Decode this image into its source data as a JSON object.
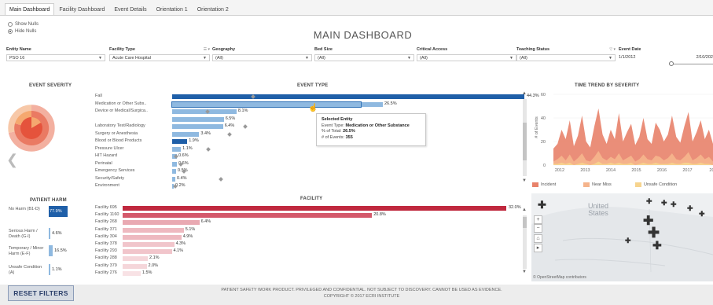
{
  "tabs": [
    {
      "label": "Main Dashboard",
      "active": true
    },
    {
      "label": "Facility Dashboard",
      "active": false
    },
    {
      "label": "Event Details",
      "active": false
    },
    {
      "label": "Orientation 1",
      "active": false
    },
    {
      "label": "Orientation 2",
      "active": false
    }
  ],
  "nulls": {
    "show": "Show Nulls",
    "hide": "Hide Nulls"
  },
  "title": "MAIN DASHBOARD",
  "filters": {
    "entity_name": {
      "label": "Entity Name",
      "value": "PSO 16"
    },
    "facility_type": {
      "label": "Facility Type",
      "value": "Acute Care Hospital",
      "ctrls": "☰ ▾"
    },
    "geography": {
      "label": "Geography",
      "value": "(All)"
    },
    "bed_size": {
      "label": "Bed Size",
      "value": "(All)"
    },
    "critical_access": {
      "label": "Critical Access",
      "value": "(All)"
    },
    "teaching_status": {
      "label": "Teaching Status",
      "value": "(All)",
      "ctrls": "▽ ▾"
    },
    "event_date": {
      "label": "Event Date",
      "start": "1/1/2012",
      "end": "2/10/202"
    }
  },
  "sections": {
    "event_severity": "EVENT SEVERITY",
    "event_type": "EVENT TYPE",
    "time_trend": "TIME TREND BY SEVERITY",
    "patient_harm": "PATIENT HARM",
    "facility": "FACILITY"
  },
  "event_type": {
    "items": [
      {
        "label": "Fall",
        "value": "44.3%",
        "pct": 44.3
      },
      {
        "label": "Medication or Other Subs..",
        "value": "26.5%",
        "pct": 26.5,
        "selected": true
      },
      {
        "label": "Device or Medical/Surgica..",
        "value": "8.1%",
        "pct": 8.1
      },
      {
        "label": "",
        "value": "6.5%",
        "pct": 6.5
      },
      {
        "label": "Laboratory Test/Radiology",
        "value": "6.4%",
        "pct": 6.4
      },
      {
        "label": "Surgery or Anesthesia",
        "value": "3.4%",
        "pct": 3.4
      },
      {
        "label": "Blood or Blood Products",
        "value": "1.9%",
        "pct": 1.9
      },
      {
        "label": "Pressure Ulcer",
        "value": "1.1%",
        "pct": 1.1
      },
      {
        "label": "HIT Hazard",
        "value": "0.6%",
        "pct": 0.6
      },
      {
        "label": "Perinatal",
        "value": "0.6%",
        "pct": 0.6
      },
      {
        "label": "Emergency Services",
        "value": "0.5%",
        "pct": 0.5
      },
      {
        "label": "Security/Safety",
        "value": "0.4%",
        "pct": 0.4
      },
      {
        "label": "Environment",
        "value": "0.2%",
        "pct": 0.2
      }
    ]
  },
  "tooltip": {
    "title": "Selected Entity",
    "event_type_label": "Event Type:",
    "event_type_value": "Medication or Other Substance",
    "pct_total_label": "% of Total:",
    "pct_total_value": "26.5%",
    "events_label": "# of Events:",
    "events_value": "355"
  },
  "patient_harm": {
    "items": [
      {
        "label": "No Harm (B1-D)",
        "value": "77.9%",
        "pct": 77.9
      },
      {
        "label": "Serious Harm / Death (G-I)",
        "value": "4.6%",
        "pct": 4.6
      },
      {
        "label": "Temporary / Minor Harm (E-F)",
        "value": "16.5%",
        "pct": 16.5
      },
      {
        "label": "Unsafe Condition (A)",
        "value": "1.1%",
        "pct": 1.1
      }
    ]
  },
  "facility": {
    "items": [
      {
        "label": "Facility 695",
        "value": "32.0%",
        "pct": 32.0
      },
      {
        "label": "Facility 1160",
        "value": "20.8%",
        "pct": 20.8
      },
      {
        "label": "Facility 268",
        "value": "6.4%",
        "pct": 6.4
      },
      {
        "label": "Facility 371",
        "value": "5.1%",
        "pct": 5.1
      },
      {
        "label": "Facility 304",
        "value": "4.9%",
        "pct": 4.9
      },
      {
        "label": "Facility 378",
        "value": "4.3%",
        "pct": 4.3
      },
      {
        "label": "Facility 293",
        "value": "4.1%",
        "pct": 4.1
      },
      {
        "label": "Facility 288",
        "value": "2.1%",
        "pct": 2.1
      },
      {
        "label": "Facility 379",
        "value": "2.0%",
        "pct": 2.0
      },
      {
        "label": "Facility 276",
        "value": "1.5%",
        "pct": 1.5
      }
    ]
  },
  "chart_data": [
    {
      "type": "area",
      "title": "TIME TREND BY SEVERITY",
      "ylabel": "# of Events",
      "ylim": [
        0,
        60
      ],
      "yticks": [
        "60",
        "40",
        "20",
        "0"
      ],
      "xticks": [
        "2012",
        "2013",
        "2014",
        "2015",
        "2016",
        "2017",
        "201"
      ],
      "series": [
        {
          "name": "Incident",
          "values": [
            14,
            18,
            30,
            22,
            38,
            16,
            25,
            42,
            20,
            15,
            33,
            48,
            26,
            18,
            30,
            22,
            44,
            20,
            28,
            35,
            17,
            24,
            40,
            22,
            18,
            36,
            30,
            20,
            26,
            42,
            24,
            19,
            33,
            45,
            20,
            28,
            38,
            22,
            30,
            18
          ]
        },
        {
          "name": "Near Miss",
          "values": [
            3,
            5,
            8,
            4,
            9,
            3,
            6,
            10,
            4,
            3,
            7,
            12,
            6,
            4,
            7,
            5,
            10,
            4,
            6,
            8,
            3,
            5,
            9,
            5,
            4,
            8,
            7,
            4,
            6,
            10,
            5,
            4,
            7,
            11,
            4,
            6,
            9,
            5,
            7,
            3
          ]
        },
        {
          "name": "Unsafe Condition",
          "values": [
            1,
            1,
            2,
            1,
            2,
            0,
            1,
            2,
            1,
            0,
            1,
            3,
            1,
            1,
            2,
            1,
            2,
            1,
            1,
            2,
            0,
            1,
            2,
            1,
            1,
            2,
            1,
            1,
            1,
            2,
            1,
            1,
            2,
            2,
            1,
            1,
            2,
            1,
            1,
            0
          ]
        }
      ]
    }
  ],
  "legend": [
    {
      "label": "Incident",
      "color": "#e8826a"
    },
    {
      "label": "Near Miss",
      "color": "#f5b48c"
    },
    {
      "label": "Unsafe Condition",
      "color": "#f7d48e"
    }
  ],
  "map": {
    "country_label_1": "United",
    "country_label_2": "States",
    "attribution": "© OpenStreetMap contributors",
    "zoom_in": "+",
    "zoom_out": "−"
  },
  "footer": {
    "reset": "RESET FILTERS",
    "line1": "PATIENT SAFETY WORK PRODUCT. PRIVILEGED AND CONFIDENTIAL. NOT SUBJECT TO DISCOVERY. CANNOT BE USED AS EVIDENCE.",
    "line2": "COPYRIGHT © 2017 ECRI INSTITUTE"
  },
  "colors": {
    "dark_blue": "#1f5fa8",
    "light_blue": "#8fb9e0",
    "dark_red": "#c0283e"
  }
}
